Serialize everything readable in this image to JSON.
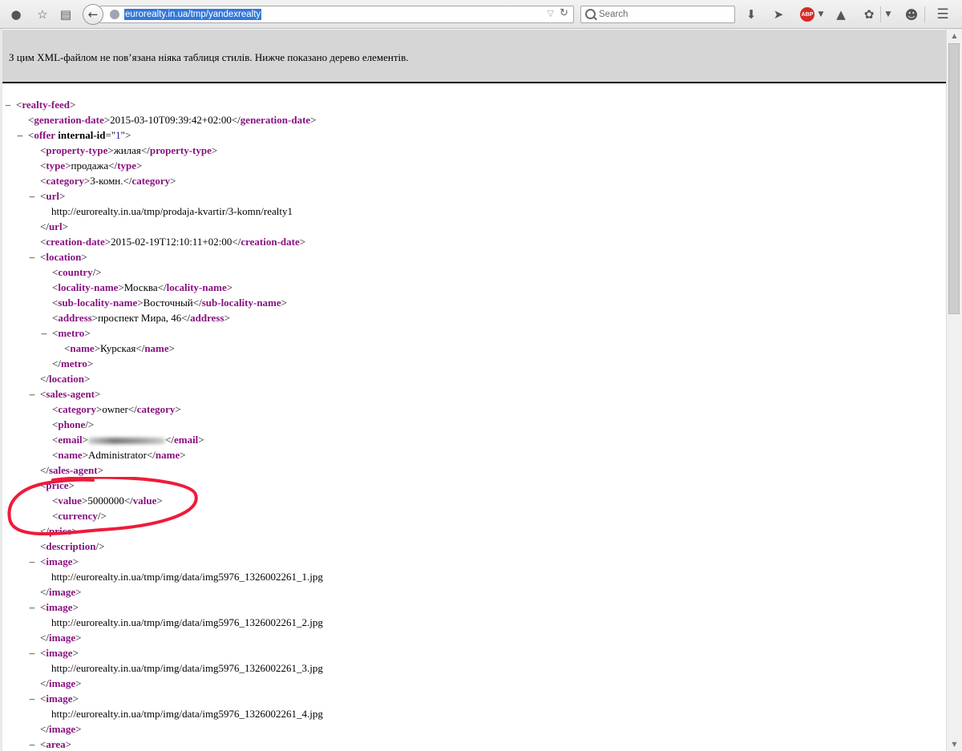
{
  "browser": {
    "url": "eurorealty.in.ua/tmp/yandexrealty",
    "search_placeholder": "Search",
    "abp_label": "ABP"
  },
  "icons": [
    "identity-icon",
    "star-icon",
    "reading-list-icon",
    "back-icon",
    "globe-icon",
    "dropdown-icon",
    "reload-icon",
    "search-icon",
    "download-icon",
    "send-icon",
    "adblock-icon",
    "spy-icon",
    "addon-icon",
    "smiley-icon",
    "menu-icon"
  ],
  "notice": "З цим XML-файлом не пов’язана ніяка таблиця стилів. Нижче показано дерево елементів.",
  "xml": {
    "root": "realty-feed",
    "generation_date": "2015-03-10T09:39:42+02:00",
    "offer_attr_name": "internal-id",
    "offer_attr_value": "1",
    "property_type": "жилая",
    "type": "продажа",
    "category": "3-комн.",
    "url": "http://eurorealty.in.ua/tmp/prodaja-kvartir/3-komn/realty1",
    "creation_date": "2015-02-19T12:10:11+02:00",
    "locality_name": "Москва",
    "sub_locality_name": "Восточный",
    "address": "проспект Мира, 46",
    "metro_name": "Курская",
    "agent_category": "owner",
    "agent_name": "Administrator",
    "price_value": "5000000",
    "images": [
      "http://eurorealty.in.ua/tmp/img/data/img5976_1326002261_1.jpg",
      "http://eurorealty.in.ua/tmp/img/data/img5976_1326002261_2.jpg",
      "http://eurorealty.in.ua/tmp/img/data/img5976_1326002261_3.jpg",
      "http://eurorealty.in.ua/tmp/img/data/img5976_1326002261_4.jpg"
    ]
  },
  "annotation_color": "#ee1b3a"
}
